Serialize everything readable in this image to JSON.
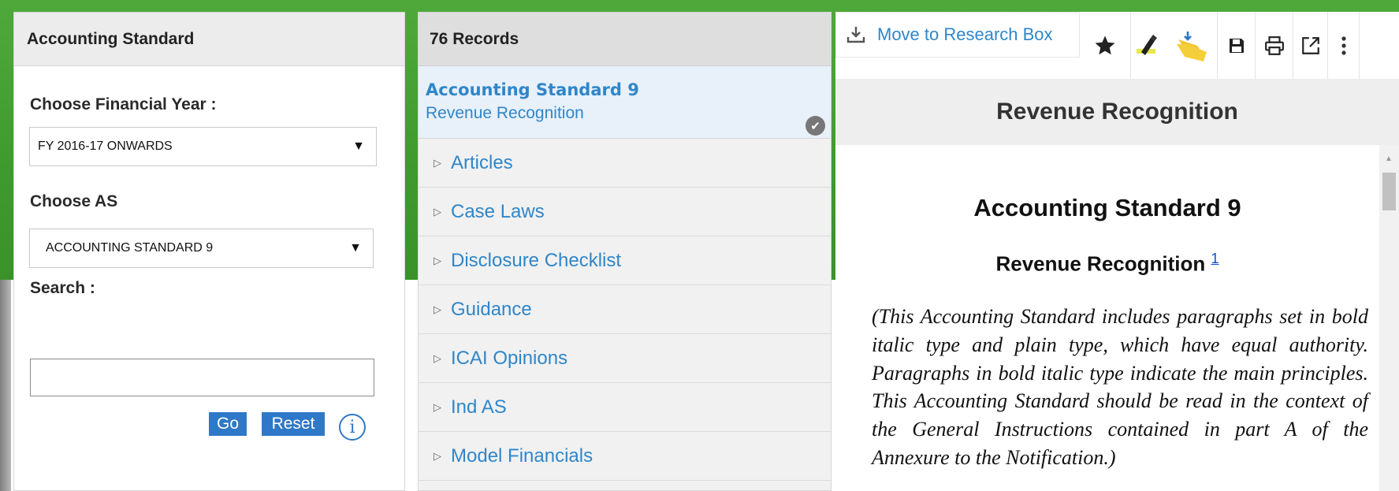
{
  "left_panel": {
    "title": "Accounting Standard",
    "financial_year_label": "Choose Financial Year :",
    "financial_year_value": "FY 2016-17 ONWARDS",
    "as_label": "Choose AS",
    "as_value": "ACCOUNTING STANDARD 9",
    "search_label": "Search :",
    "search_value": "",
    "go_label": "Go",
    "reset_label": "Reset"
  },
  "records_panel": {
    "title": "76 Records",
    "selected": {
      "title": "Accounting Standard 9",
      "subtitle": "Revenue Recognition"
    },
    "items": [
      {
        "label": "Articles"
      },
      {
        "label": "Case Laws"
      },
      {
        "label": "Disclosure Checklist"
      },
      {
        "label": "Guidance"
      },
      {
        "label": "ICAI Opinions"
      },
      {
        "label": "Ind AS"
      },
      {
        "label": "Model Financials"
      }
    ]
  },
  "document_panel": {
    "move_label": "Move to Research Box",
    "toolbar_icons": [
      "star-icon",
      "highlighter-icon",
      "folder-icon",
      "save-icon",
      "print-icon",
      "external-link-icon",
      "more-vertical-icon"
    ],
    "header_title": "Revenue Recognition",
    "doc_title": "Accounting Standard 9",
    "doc_subtitle": "Revenue Recognition",
    "footnote": "1",
    "paragraph": "(This Accounting Standard includes paragraphs set in bold italic type and plain type, which have equal authority. Paragraphs in bold italic type indicate the main principles. This Accounting Standard should be read in the context of the General Instructions contained in part A of the Annexure to the Notification.)"
  },
  "colors": {
    "background_green": "#3f9a2e",
    "link_blue": "#2f86c9",
    "button_blue": "#2f78c7"
  }
}
